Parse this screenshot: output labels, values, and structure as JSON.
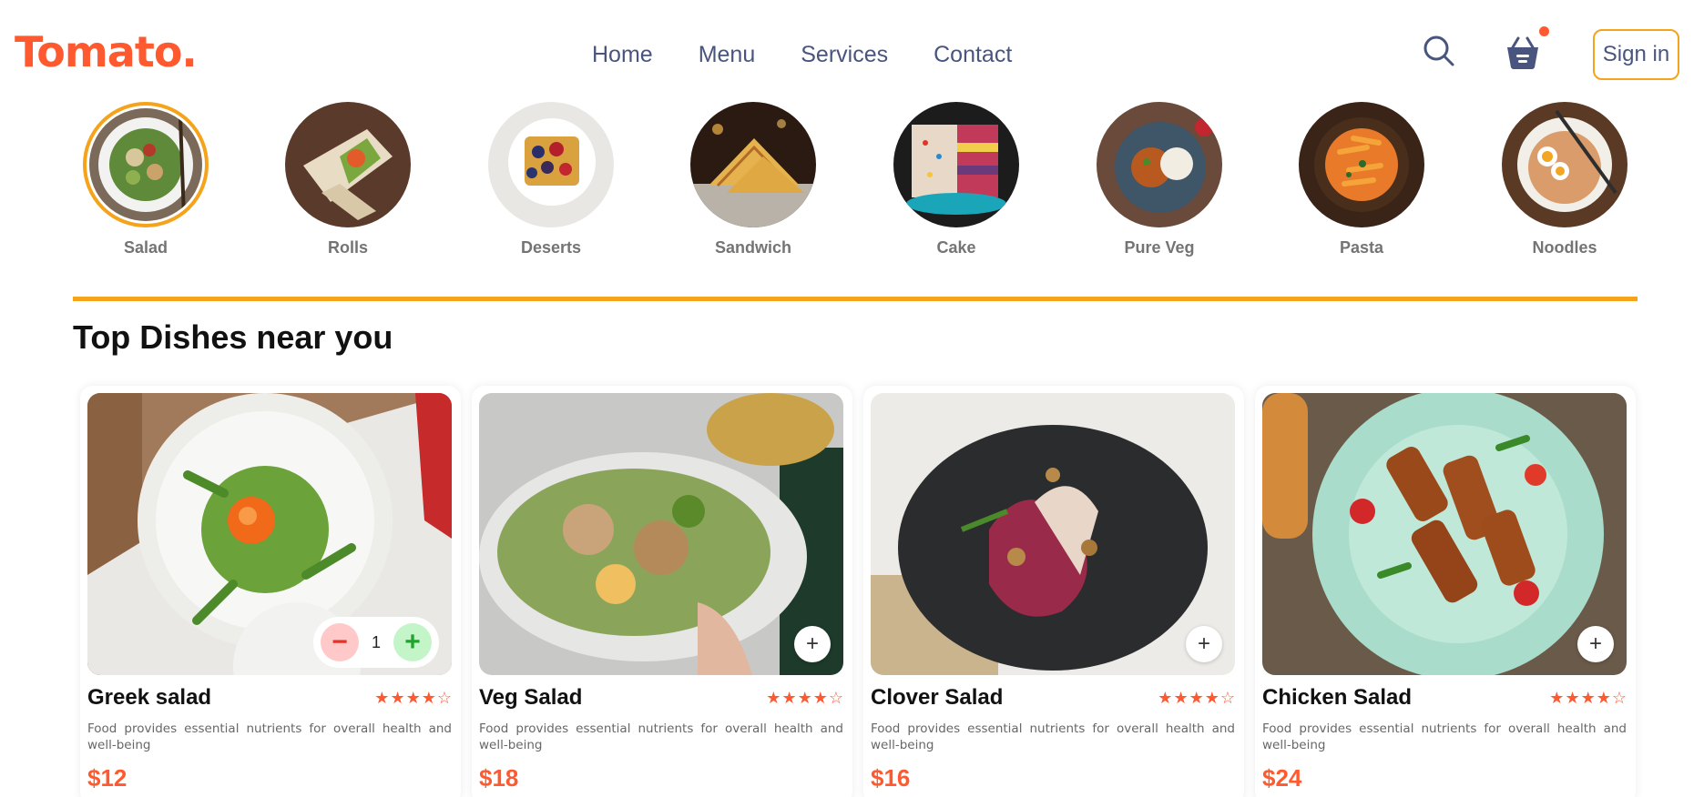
{
  "brand": {
    "logo": "Tomato."
  },
  "nav": {
    "links": [
      "Home",
      "Menu",
      "Services",
      "Contact"
    ],
    "sign_in": "Sign in"
  },
  "colors": {
    "accent": "#ff5a2f",
    "highlight": "#f5a31a",
    "nav_text": "#49557e"
  },
  "categories": [
    {
      "label": "Salad",
      "active": true
    },
    {
      "label": "Rolls"
    },
    {
      "label": "Deserts"
    },
    {
      "label": "Sandwich"
    },
    {
      "label": "Cake"
    },
    {
      "label": "Pure Veg"
    },
    {
      "label": "Pasta"
    },
    {
      "label": "Noodles"
    }
  ],
  "section": {
    "title": "Top Dishes near you"
  },
  "dishes": [
    {
      "name": "Greek salad",
      "rating": 4,
      "max_rating": 5,
      "description": "Food provides essential nutrients for overall health and well-being",
      "price": "$12",
      "in_cart": true,
      "quantity": "1"
    },
    {
      "name": "Veg Salad",
      "rating": 4,
      "max_rating": 5,
      "description": "Food provides essential nutrients for overall health and well-being",
      "price": "$18",
      "in_cart": false
    },
    {
      "name": "Clover Salad",
      "rating": 4,
      "max_rating": 5,
      "description": "Food provides essential nutrients for overall health and well-being",
      "price": "$16",
      "in_cart": false
    },
    {
      "name": "Chicken Salad",
      "rating": 4,
      "max_rating": 5,
      "description": "Food provides essential nutrients for overall health and well-being",
      "price": "$24",
      "in_cart": false
    }
  ]
}
